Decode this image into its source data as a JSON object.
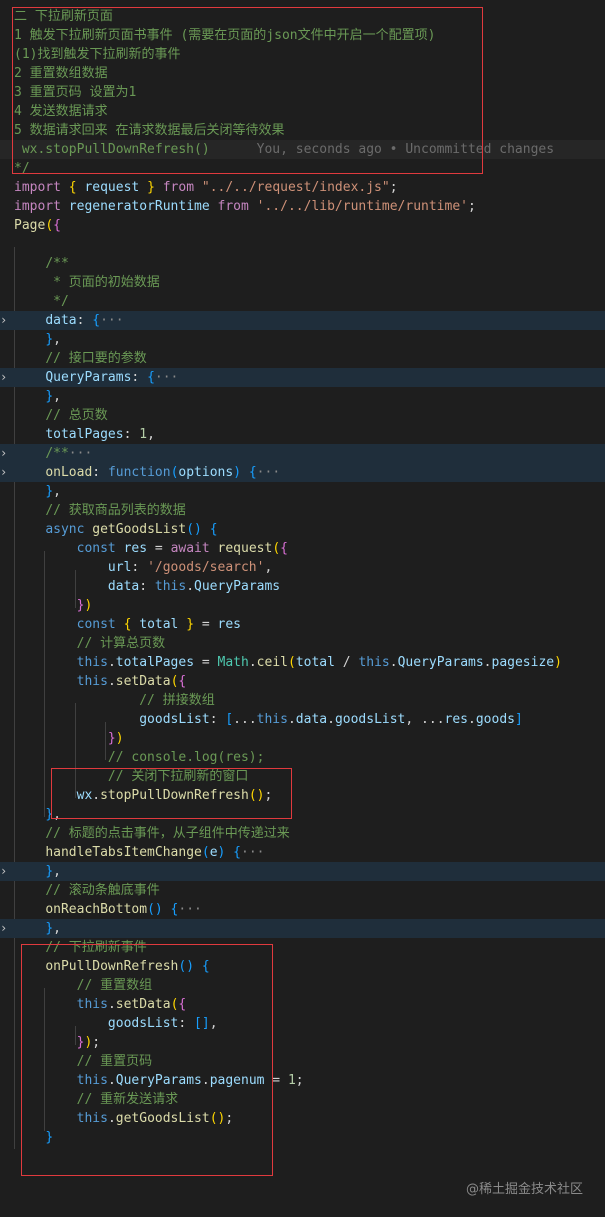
{
  "editor": {
    "watermark": "@稀土掘金技术社区",
    "lines": [
      [
        [
          "cm",
          "二 下拉刷新页面"
        ]
      ],
      [
        [
          "cm",
          "1 触发下拉刷新页面书事件 (需要在页面的json文件中开启一个配置项)"
        ]
      ],
      [
        [
          "cm",
          "(1)找到触发下拉刷新的事件"
        ]
      ],
      [
        [
          "cm",
          "2 重置数组数据"
        ]
      ],
      [
        [
          "cm",
          "3 重置页码 设置为1"
        ]
      ],
      [
        [
          "cm",
          "4 发送数据请求"
        ]
      ],
      [
        [
          "cm",
          "5 数据请求回来 在请求数据最后关闭等待效果"
        ]
      ],
      [
        [
          "cm",
          " wx.stopPullDownRefresh()"
        ],
        [
          "blame",
          "      You, seconds ago • Uncommitted changes"
        ]
      ],
      [
        [
          "cm",
          "*/"
        ]
      ],
      [
        [
          "ctl",
          "import"
        ],
        [
          "txt",
          " "
        ],
        [
          "b1",
          "{"
        ],
        [
          "txt",
          " "
        ],
        [
          "var",
          "request"
        ],
        [
          "txt",
          " "
        ],
        [
          "b1",
          "}"
        ],
        [
          "txt",
          " "
        ],
        [
          "ctl",
          "from"
        ],
        [
          "txt",
          " "
        ],
        [
          "str",
          "\"../../request/index.js\""
        ],
        [
          "txt",
          ";"
        ]
      ],
      [
        [
          "ctl",
          "import"
        ],
        [
          "txt",
          " "
        ],
        [
          "var",
          "regeneratorRuntime"
        ],
        [
          "txt",
          " "
        ],
        [
          "ctl",
          "from"
        ],
        [
          "txt",
          " "
        ],
        [
          "str",
          "'../../lib/runtime/runtime'"
        ],
        [
          "txt",
          ";"
        ]
      ],
      [
        [
          "fn",
          "Page"
        ],
        [
          "b1",
          "("
        ],
        [
          "b2",
          "{"
        ]
      ],
      [],
      [
        [
          "txt",
          "    "
        ],
        [
          "cm",
          "/**"
        ]
      ],
      [
        [
          "txt",
          "    "
        ],
        [
          "cm",
          " * 页面的初始数据"
        ]
      ],
      [
        [
          "txt",
          "    "
        ],
        [
          "cm",
          " */"
        ]
      ],
      [
        [
          "txt",
          "    "
        ],
        [
          "var",
          "data"
        ],
        [
          "txt",
          ": "
        ],
        [
          "b3",
          "{"
        ],
        [
          "dim",
          "···"
        ]
      ],
      [
        [
          "txt",
          "    "
        ],
        [
          "b3",
          "}"
        ],
        [
          "txt",
          ","
        ]
      ],
      [
        [
          "txt",
          "    "
        ],
        [
          "cm",
          "// 接口要的参数"
        ]
      ],
      [
        [
          "txt",
          "    "
        ],
        [
          "var",
          "QueryParams"
        ],
        [
          "txt",
          ": "
        ],
        [
          "b3",
          "{"
        ],
        [
          "dim",
          "···"
        ]
      ],
      [
        [
          "txt",
          "    "
        ],
        [
          "b3",
          "}"
        ],
        [
          "txt",
          ","
        ]
      ],
      [
        [
          "txt",
          "    "
        ],
        [
          "cm",
          "// 总页数"
        ]
      ],
      [
        [
          "txt",
          "    "
        ],
        [
          "var",
          "totalPages"
        ],
        [
          "txt",
          ": "
        ],
        [
          "num",
          "1"
        ],
        [
          "txt",
          ","
        ]
      ],
      [
        [
          "txt",
          "    "
        ],
        [
          "cm",
          "/**"
        ],
        [
          "dim",
          "···"
        ]
      ],
      [
        [
          "txt",
          "    "
        ],
        [
          "fn",
          "onLoad"
        ],
        [
          "txt",
          ": "
        ],
        [
          "kw",
          "function"
        ],
        [
          "b3",
          "("
        ],
        [
          "var",
          "options"
        ],
        [
          "b3",
          ")"
        ],
        [
          "txt",
          " "
        ],
        [
          "b3",
          "{"
        ],
        [
          "dim",
          "···"
        ]
      ],
      [
        [
          "txt",
          "    "
        ],
        [
          "b3",
          "}"
        ],
        [
          "txt",
          ","
        ]
      ],
      [
        [
          "txt",
          "    "
        ],
        [
          "cm",
          "// 获取商品列表的数据"
        ]
      ],
      [
        [
          "txt",
          "    "
        ],
        [
          "kw",
          "async"
        ],
        [
          "txt",
          " "
        ],
        [
          "fn",
          "getGoodsList"
        ],
        [
          "b3",
          "()"
        ],
        [
          "txt",
          " "
        ],
        [
          "b3",
          "{"
        ]
      ],
      [
        [
          "txt",
          "        "
        ],
        [
          "kw",
          "const"
        ],
        [
          "txt",
          " "
        ],
        [
          "var",
          "res"
        ],
        [
          "txt",
          " = "
        ],
        [
          "ctl",
          "await"
        ],
        [
          "txt",
          " "
        ],
        [
          "fn",
          "request"
        ],
        [
          "b1",
          "("
        ],
        [
          "b2",
          "{"
        ]
      ],
      [
        [
          "txt",
          "            "
        ],
        [
          "var",
          "url"
        ],
        [
          "txt",
          ": "
        ],
        [
          "str",
          "'/goods/search'"
        ],
        [
          "txt",
          ","
        ]
      ],
      [
        [
          "txt",
          "            "
        ],
        [
          "var",
          "data"
        ],
        [
          "txt",
          ": "
        ],
        [
          "kw",
          "this"
        ],
        [
          "txt",
          "."
        ],
        [
          "var",
          "QueryParams"
        ]
      ],
      [
        [
          "txt",
          "        "
        ],
        [
          "b2",
          "}"
        ],
        [
          "b1",
          ")"
        ]
      ],
      [
        [
          "txt",
          "        "
        ],
        [
          "kw",
          "const"
        ],
        [
          "txt",
          " "
        ],
        [
          "b1",
          "{"
        ],
        [
          "txt",
          " "
        ],
        [
          "var",
          "total"
        ],
        [
          "txt",
          " "
        ],
        [
          "b1",
          "}"
        ],
        [
          "txt",
          " = "
        ],
        [
          "var",
          "res"
        ]
      ],
      [
        [
          "txt",
          "        "
        ],
        [
          "cm",
          "// 计算总页数"
        ]
      ],
      [
        [
          "txt",
          "        "
        ],
        [
          "kw",
          "this"
        ],
        [
          "txt",
          "."
        ],
        [
          "var",
          "totalPages"
        ],
        [
          "txt",
          " = "
        ],
        [
          "cls",
          "Math"
        ],
        [
          "txt",
          "."
        ],
        [
          "fn",
          "ceil"
        ],
        [
          "b1",
          "("
        ],
        [
          "var",
          "total"
        ],
        [
          "txt",
          " / "
        ],
        [
          "kw",
          "this"
        ],
        [
          "txt",
          "."
        ],
        [
          "var",
          "QueryParams"
        ],
        [
          "txt",
          "."
        ],
        [
          "var",
          "pagesize"
        ],
        [
          "b1",
          ")"
        ]
      ],
      [
        [
          "txt",
          "        "
        ],
        [
          "kw",
          "this"
        ],
        [
          "txt",
          "."
        ],
        [
          "fn",
          "setData"
        ],
        [
          "b1",
          "("
        ],
        [
          "b2",
          "{"
        ]
      ],
      [
        [
          "txt",
          "                "
        ],
        [
          "cm",
          "// 拼接数组"
        ]
      ],
      [
        [
          "txt",
          "                "
        ],
        [
          "var",
          "goodsList"
        ],
        [
          "txt",
          ": "
        ],
        [
          "b3",
          "["
        ],
        [
          "txt",
          "..."
        ],
        [
          "kw",
          "this"
        ],
        [
          "txt",
          "."
        ],
        [
          "var",
          "data"
        ],
        [
          "txt",
          "."
        ],
        [
          "var",
          "goodsList"
        ],
        [
          "txt",
          ", ..."
        ],
        [
          "var",
          "res"
        ],
        [
          "txt",
          "."
        ],
        [
          "var",
          "goods"
        ],
        [
          "b3",
          "]"
        ]
      ],
      [
        [
          "txt",
          "            "
        ],
        [
          "b2",
          "}"
        ],
        [
          "b1",
          ")"
        ]
      ],
      [
        [
          "txt",
          "            "
        ],
        [
          "cm",
          "// console.log(res);"
        ]
      ],
      [
        [
          "txt",
          "            "
        ],
        [
          "cm",
          "// 关闭下拉刷新的窗口"
        ]
      ],
      [
        [
          "txt",
          "        "
        ],
        [
          "var",
          "wx"
        ],
        [
          "txt",
          "."
        ],
        [
          "fn",
          "stopPullDownRefresh"
        ],
        [
          "b1",
          "()"
        ],
        [
          "txt",
          ";"
        ]
      ],
      [
        [
          "txt",
          "    "
        ],
        [
          "b3",
          "}"
        ],
        [
          "txt",
          ","
        ]
      ],
      [
        [
          "txt",
          "    "
        ],
        [
          "cm",
          "// 标题的点击事件，从子组件中传递过来"
        ]
      ],
      [
        [
          "txt",
          "    "
        ],
        [
          "fn",
          "handleTabsItemChange"
        ],
        [
          "b3",
          "("
        ],
        [
          "var",
          "e"
        ],
        [
          "b3",
          ")"
        ],
        [
          "txt",
          " "
        ],
        [
          "b3",
          "{"
        ],
        [
          "dim",
          "···"
        ]
      ],
      [
        [
          "txt",
          "    "
        ],
        [
          "b3",
          "}"
        ],
        [
          "txt",
          ","
        ]
      ],
      [
        [
          "txt",
          "    "
        ],
        [
          "cm",
          "// 滚动条触底事件"
        ]
      ],
      [
        [
          "txt",
          "    "
        ],
        [
          "fn",
          "onReachBottom"
        ],
        [
          "b3",
          "()"
        ],
        [
          "txt",
          " "
        ],
        [
          "b3",
          "{"
        ],
        [
          "dim",
          "···"
        ]
      ],
      [
        [
          "txt",
          "    "
        ],
        [
          "b3",
          "}"
        ],
        [
          "txt",
          ","
        ]
      ],
      [
        [
          "txt",
          "    "
        ],
        [
          "cm",
          "// 下拉刷新事件"
        ]
      ],
      [
        [
          "txt",
          "    "
        ],
        [
          "fn",
          "onPullDownRefresh"
        ],
        [
          "b3",
          "()"
        ],
        [
          "txt",
          " "
        ],
        [
          "b3",
          "{"
        ]
      ],
      [
        [
          "txt",
          "        "
        ],
        [
          "cm",
          "// 重置数组"
        ]
      ],
      [
        [
          "txt",
          "        "
        ],
        [
          "kw",
          "this"
        ],
        [
          "txt",
          "."
        ],
        [
          "fn",
          "setData"
        ],
        [
          "b1",
          "("
        ],
        [
          "b2",
          "{"
        ]
      ],
      [
        [
          "txt",
          "            "
        ],
        [
          "var",
          "goodsList"
        ],
        [
          "txt",
          ": "
        ],
        [
          "b3",
          "[]"
        ],
        [
          "txt",
          ","
        ]
      ],
      [
        [
          "txt",
          "        "
        ],
        [
          "b2",
          "}"
        ],
        [
          "b1",
          ")"
        ],
        [
          "txt",
          ";"
        ]
      ],
      [
        [
          "txt",
          "        "
        ],
        [
          "cm",
          "// 重置页码"
        ]
      ],
      [
        [
          "txt",
          "        "
        ],
        [
          "kw",
          "this"
        ],
        [
          "txt",
          "."
        ],
        [
          "var",
          "QueryParams"
        ],
        [
          "txt",
          "."
        ],
        [
          "var",
          "pagenum"
        ],
        [
          "txt",
          " = "
        ],
        [
          "num",
          "1"
        ],
        [
          "txt",
          ";"
        ]
      ],
      [
        [
          "txt",
          "        "
        ],
        [
          "cm",
          "// 重新发送请求"
        ]
      ],
      [
        [
          "txt",
          "        "
        ],
        [
          "kw",
          "this"
        ],
        [
          "txt",
          "."
        ],
        [
          "fn",
          "getGoodsList"
        ],
        [
          "b1",
          "()"
        ],
        [
          "txt",
          ";"
        ]
      ],
      [
        [
          "txt",
          "    "
        ],
        [
          "b3",
          "}"
        ]
      ]
    ]
  }
}
